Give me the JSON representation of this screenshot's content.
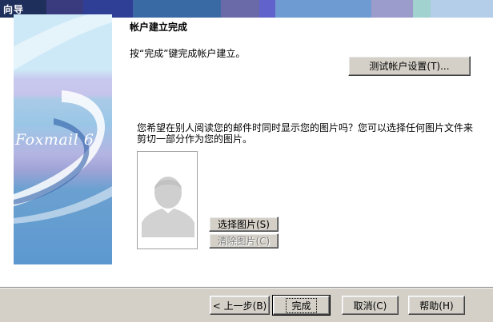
{
  "window": {
    "title": "向导"
  },
  "titlebar_colors": [
    "#2d3f6e",
    "#3a3a7e",
    "#2e3f8c",
    "#3a6aa4",
    "#4d7db3",
    "#6a6aa8",
    "#6464d0",
    "#6a9ad0",
    "#8ab0dc",
    "#a0a0d0",
    "#a0d0d0",
    "#b0c8e8"
  ],
  "banner": {
    "logo_text": "Foxmail 6"
  },
  "main": {
    "heading": "帐户建立完成",
    "instruction": "按“完成”键完成帐户建立。",
    "test_settings_label": "测试帐户设置(T)...",
    "picture_question": "您希望在别人阅读您的邮件时同时显示您的图片吗？您可以选择任何图片文件来剪切一部分作为您的图片。",
    "select_picture_label": "选择图片(S)",
    "clear_picture_label": "清除图片(C)"
  },
  "footer": {
    "back_label": "< 上一步(B)",
    "finish_label": "完成",
    "cancel_label": "取消(C)",
    "help_label": "帮助(H)"
  }
}
